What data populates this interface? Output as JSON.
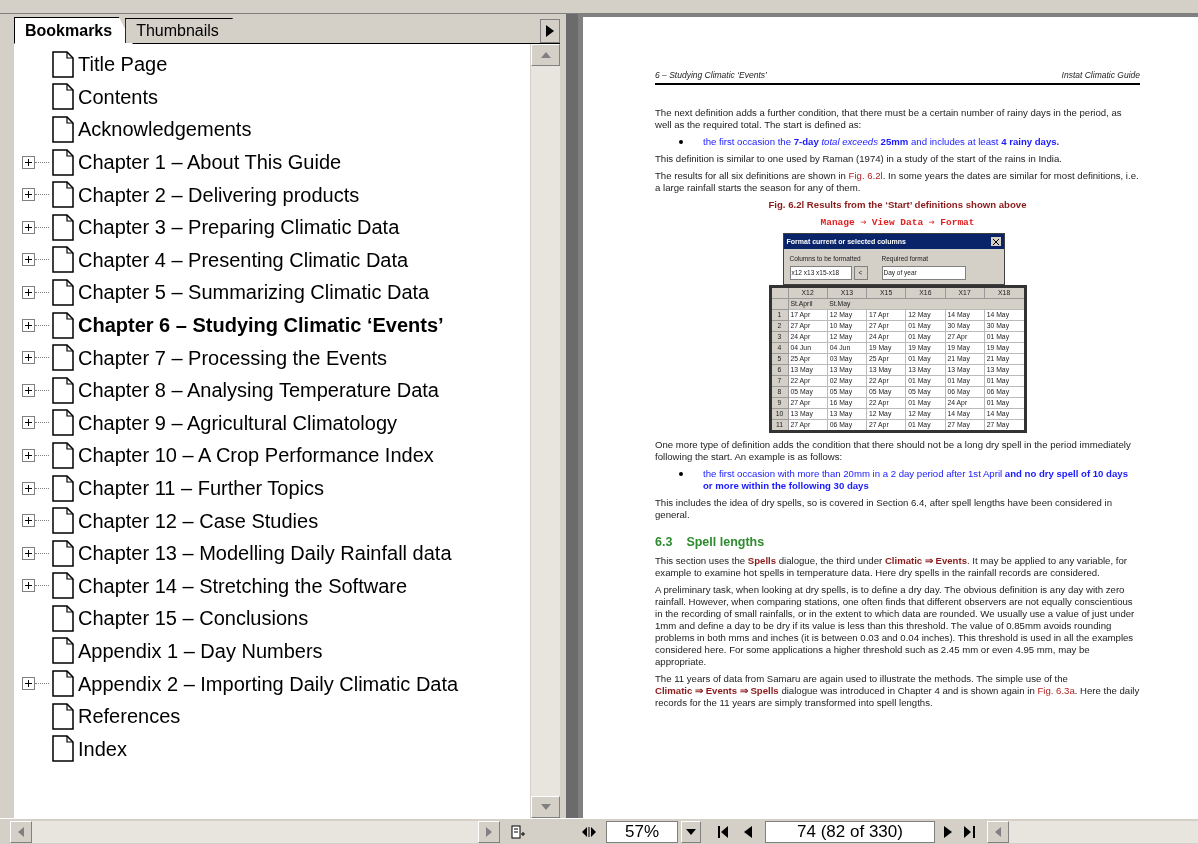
{
  "sidebar": {
    "tabs": [
      {
        "label": "Bookmarks",
        "selected": true
      },
      {
        "label": "Thumbnails",
        "selected": false
      }
    ],
    "bookmarks": [
      {
        "label": "Title Page",
        "expandable": false,
        "selected": false
      },
      {
        "label": "Contents",
        "expandable": false,
        "selected": false
      },
      {
        "label": "Acknowledgements",
        "expandable": false,
        "selected": false
      },
      {
        "label": "Chapter 1 – About This Guide",
        "expandable": true,
        "selected": false
      },
      {
        "label": "Chapter 2 – Delivering products",
        "expandable": true,
        "selected": false
      },
      {
        "label": "Chapter 3 – Preparing Climatic Data",
        "expandable": true,
        "selected": false
      },
      {
        "label": "Chapter 4 – Presenting Climatic Data",
        "expandable": true,
        "selected": false
      },
      {
        "label": "Chapter 5 – Summarizing Climatic Data",
        "expandable": true,
        "selected": false
      },
      {
        "label": "Chapter 6 – Studying Climatic ‘Events’",
        "expandable": true,
        "selected": true
      },
      {
        "label": "Chapter 7 – Processing the Events",
        "expandable": true,
        "selected": false
      },
      {
        "label": "Chapter 8 – Analysing Temperature Data",
        "expandable": true,
        "selected": false
      },
      {
        "label": "Chapter 9 – Agricultural Climatology",
        "expandable": true,
        "selected": false
      },
      {
        "label": "Chapter 10 – A Crop Performance Index",
        "expandable": true,
        "selected": false
      },
      {
        "label": "Chapter 11 – Further Topics",
        "expandable": true,
        "selected": false
      },
      {
        "label": "Chapter 12 – Case Studies",
        "expandable": true,
        "selected": false
      },
      {
        "label": "Chapter 13 – Modelling Daily Rainfall data",
        "expandable": true,
        "selected": false
      },
      {
        "label": "Chapter 14 – Stretching the Software",
        "expandable": true,
        "selected": false
      },
      {
        "label": "Chapter 15 – Conclusions",
        "expandable": false,
        "selected": false
      },
      {
        "label": "Appendix 1 – Day Numbers",
        "expandable": false,
        "selected": false
      },
      {
        "label": "Appendix 2 – Importing Daily Climatic Data",
        "expandable": true,
        "selected": false
      },
      {
        "label": "References",
        "expandable": false,
        "selected": false
      },
      {
        "label": "Index",
        "expandable": false,
        "selected": false
      }
    ]
  },
  "page": {
    "header_left": "6 – Studying Climatic ‘Events’",
    "header_right": "Instat Climatic Guide",
    "blocks": [
      {
        "kind": "para",
        "runs": [
          {
            "kind": "plain",
            "text": "The next definition adds a further condition, that there must be a certain number of rainy days in the period, as well as the required total.  The start is defined as:"
          }
        ]
      },
      {
        "kind": "bullet",
        "text": "the first occasion the **7-day** *total exceeds* **25mm** and includes at least **4 rainy days.**"
      },
      {
        "kind": "para",
        "runs": [
          {
            "kind": "plain",
            "text": "This definition is similar to one used by Raman (1974) in a study of the start of the rains in India."
          }
        ]
      },
      {
        "kind": "para",
        "runs": [
          {
            "kind": "plain",
            "text": "The results for all six definitions are shown in "
          },
          {
            "kind": "link",
            "text": "Fig. 6.2l"
          },
          {
            "kind": "plain",
            "text": ".  In some years the dates are similar for most definitions, i.e. a large rainfall starts the season for any of them."
          }
        ]
      },
      {
        "kind": "caption",
        "text": "Fig. 6.2l  Results from the ‘Start’ definitions shown above"
      },
      {
        "kind": "menu-path",
        "text": "Manage ⇒ View Data ⇒ Format"
      },
      {
        "kind": "figure"
      },
      {
        "kind": "para",
        "runs": [
          {
            "kind": "plain",
            "text": "One more type of definition adds the condition that there should not be a long dry spell in the period immediately following the start.  An example is as follows:"
          }
        ]
      },
      {
        "kind": "bullet",
        "text": "the first occasion with more than 20mm in a 2 day period after 1st April **and no dry spell of 10 days or more within the following 30 days**"
      },
      {
        "kind": "para",
        "runs": [
          {
            "kind": "plain",
            "text": "This includes the idea of dry spells, so is covered in Section 6.4, after spell lengths have been considered in general."
          }
        ]
      },
      {
        "kind": "heading",
        "number": "6.3",
        "text": "Spell lengths"
      },
      {
        "kind": "para",
        "runs": [
          {
            "kind": "plain",
            "text": "This section uses the "
          },
          {
            "kind": "menu",
            "text": "Spells"
          },
          {
            "kind": "plain",
            "text": " dialogue, the third under "
          },
          {
            "kind": "menu",
            "text": "Climatic ⇒ Events"
          },
          {
            "kind": "plain",
            "text": ".  It may be applied to any variable, for example to examine hot spells in temperature data.  Here dry spells in the rainfall records are considered."
          }
        ]
      },
      {
        "kind": "para",
        "runs": [
          {
            "kind": "plain",
            "text": "A preliminary task, when looking at dry spells, is to define a dry day.  The obvious definition is any day with zero rainfall.  However, when comparing stations, one often finds that different observers are not equally conscientious in the recording of small rainfalls, or in the extent to which data are rounded.  We usually use a value of just under 1mm and define a day to be dry if its value is less than this threshold.  The value of 0.85mm avoids rounding problems in both mms and inches (it is between 0.03 and 0.04 inches).  This threshold is used in all the examples considered here.  For some applications a higher threshold such as 2.45 mm or even 4.95 mm, may be appropriate."
          }
        ]
      },
      {
        "kind": "para",
        "runs": [
          {
            "kind": "plain",
            "text": "The 11 years of data from Samaru are again used to illustrate the methods.  The simple use of the "
          },
          {
            "kind": "menu",
            "text": "Climatic ⇒ Events ⇒ Spells"
          },
          {
            "kind": "plain",
            "text": " dialogue was introduced in Chapter 4 and is shown again in "
          },
          {
            "kind": "link",
            "text": "Fig. 6.3a"
          },
          {
            "kind": "plain",
            "text": ".  Here the daily records for the 11 years are simply transformed into spell lengths."
          }
        ]
      }
    ],
    "figure": {
      "dialog_title": "Format current or selected columns",
      "columns_label": "Columns to be formatted",
      "columns_value": "x12 x13 x15-x18",
      "pick_button": "<",
      "format_label": "Required format",
      "format_value": "Day of year",
      "columns": [
        "",
        "X12",
        "X13",
        "X15",
        "X16",
        "X17",
        "X18"
      ],
      "subheader": [
        "St.April",
        "St.May"
      ],
      "rows": [
        [
          "1",
          "17 Apr",
          "12 May",
          "17 Apr",
          "12 May",
          "14 May",
          "14 May"
        ],
        [
          "2",
          "27 Apr",
          "10 May",
          "27 Apr",
          "01 May",
          "30 May",
          "30 May"
        ],
        [
          "3",
          "24 Apr",
          "12 May",
          "24 Apr",
          "01 May",
          "27 Apr",
          "01 May"
        ],
        [
          "4",
          "04 Jun",
          "04 Jun",
          "19 May",
          "19 May",
          "19 May",
          "19 May"
        ],
        [
          "5",
          "25 Apr",
          "03 May",
          "25 Apr",
          "01 May",
          "21 May",
          "21 May"
        ],
        [
          "6",
          "13 May",
          "13 May",
          "13 May",
          "13 May",
          "13 May",
          "13 May"
        ],
        [
          "7",
          "22 Apr",
          "02 May",
          "22 Apr",
          "01 May",
          "01 May",
          "01 May"
        ],
        [
          "8",
          "05 May",
          "05 May",
          "05 May",
          "05 May",
          "06 May",
          "06 May"
        ],
        [
          "9",
          "27 Apr",
          "16 May",
          "22 Apr",
          "01 May",
          "24 Apr",
          "01 May"
        ],
        [
          "10",
          "13 May",
          "13 May",
          "12 May",
          "12 May",
          "14 May",
          "14 May"
        ],
        [
          "11",
          "27 Apr",
          "06 May",
          "27 Apr",
          "01 May",
          "27 May",
          "27 May"
        ]
      ]
    }
  },
  "toolbar": {
    "zoom": "57%",
    "page": "74 (82 of 330)"
  }
}
